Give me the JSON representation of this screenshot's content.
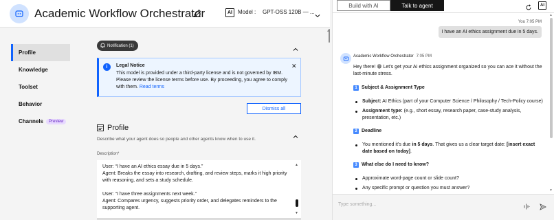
{
  "header": {
    "app_title": "Academic Workflow Orchestrator",
    "model_label": "Model :",
    "model_value": "GPT-OSS 120B — ...",
    "ai_badge": "AI"
  },
  "sidebar": {
    "items": [
      {
        "label": "Profile",
        "active": true
      },
      {
        "label": "Knowledge"
      },
      {
        "label": "Toolset"
      },
      {
        "label": "Behavior"
      },
      {
        "label": "Channels",
        "tag": "Preview"
      }
    ]
  },
  "notifications": {
    "pill_label": "Notification (1)",
    "notice_title": "Legal Notice",
    "notice_text": "This model is provided under a third-party license and is not governed by IBM. Please review the license terms before use. By proceeding, you agree to comply with them.",
    "notice_link": "Read terms",
    "dismiss_label": "Dismiss all"
  },
  "profile": {
    "heading": "Profile",
    "description": "Describe what your agent does so people and other agents know when to use it.",
    "field_label": "Description*",
    "textarea_lines": [
      "User: “I have an AI ethics essay due in 5 days.”",
      "Agent: Breaks the essay into research, drafting, and review steps, marks it high priority with reasoning, and sets a study schedule.",
      "User: “I have three assignments next week.”",
      "Agent: Compares urgency, suggests priority order, and delegates reminders to the supporting agent."
    ]
  },
  "chat": {
    "tabs": [
      "Build with AI",
      "Talk to agent"
    ],
    "active_tab": "Talk to agent",
    "ai_badge": "AI",
    "user_meta": "You 7:05 PM",
    "user_message": "I have an AI ethics assignment due in 5 days.",
    "bot_name": "Academic Workflow Orchestrator",
    "bot_time": "7:05 PM",
    "intro": "Hey there! 😁 Let’s get your AI ethics assignment organized so you can ace it without the last-minute stress.",
    "sections": [
      {
        "number": "1",
        "title": "Subject & Assignment Type",
        "bullets": [
          {
            "bold": "Subject:",
            "text": " AI Ethics (part of your Computer Science / Philosophy / Tech-Policy course)"
          },
          {
            "bold": "Assignment type:",
            "text": " (e.g., short essay, research paper, case-study analysis, presentation, etc.)"
          }
        ]
      },
      {
        "number": "2",
        "title": "Deadline",
        "bullets": [
          {
            "pre": "You mentioned it’s due ",
            "bold": "in 5 days",
            "text": ". That gives us a clear target date: ",
            "bold2": "[insert exact date based on today]",
            "post": "."
          }
        ]
      },
      {
        "number": "3",
        "title": "What else do I need to know?",
        "bullets": [
          {
            "text": "Approximate word-page count or slide count?"
          },
          {
            "text": "Any specific prompt or question you must answer?"
          }
        ]
      }
    ],
    "input_placeholder": "Type something..."
  },
  "icons": {
    "app": "agent-icon",
    "edit": "pencil-icon",
    "bell": "bell-icon",
    "info": "info-icon",
    "close": "close-icon",
    "profile": "profile-card-icon",
    "reset": "reset-icon",
    "mic": "microphone-icon",
    "send": "send-icon"
  },
  "colors": {
    "accent": "#0f62fe",
    "dark": "#161616",
    "notice_bg": "#edf5ff",
    "preview_tag": "#e8daff"
  }
}
